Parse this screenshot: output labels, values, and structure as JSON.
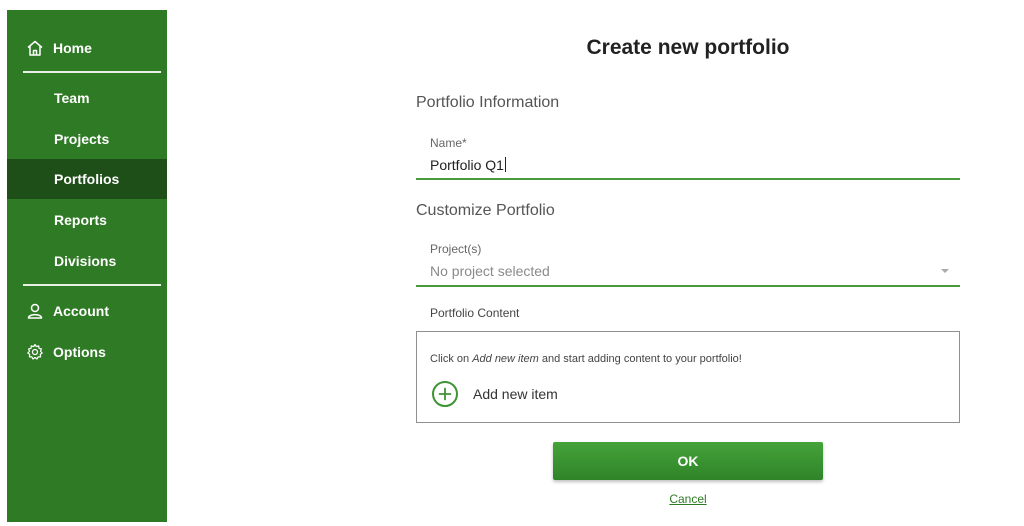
{
  "sidebar": {
    "home_label": "Home",
    "items": [
      {
        "label": "Team"
      },
      {
        "label": "Projects"
      },
      {
        "label": "Portfolios",
        "active": true
      },
      {
        "label": "Reports"
      },
      {
        "label": "Divisions"
      }
    ],
    "account_label": "Account",
    "options_label": "Options",
    "bg_color": "#2f7a25",
    "active_color": "#1f4f19"
  },
  "main": {
    "title": "Create new portfolio",
    "info_section": "Portfolio Information",
    "name_label": "Name*",
    "name_value": "Portfolio Q1",
    "customize_section": "Customize Portfolio",
    "projects_label": "Project(s)",
    "projects_placeholder": "No project selected",
    "content_label": "Portfolio Content",
    "content_hint_prefix": "Click on ",
    "content_hint_em": "Add new item",
    "content_hint_suffix": " and start adding content to your portfolio!",
    "add_item_label": "Add new item",
    "ok_label": "OK",
    "cancel_label": "Cancel",
    "accent_color": "#3e9334"
  }
}
